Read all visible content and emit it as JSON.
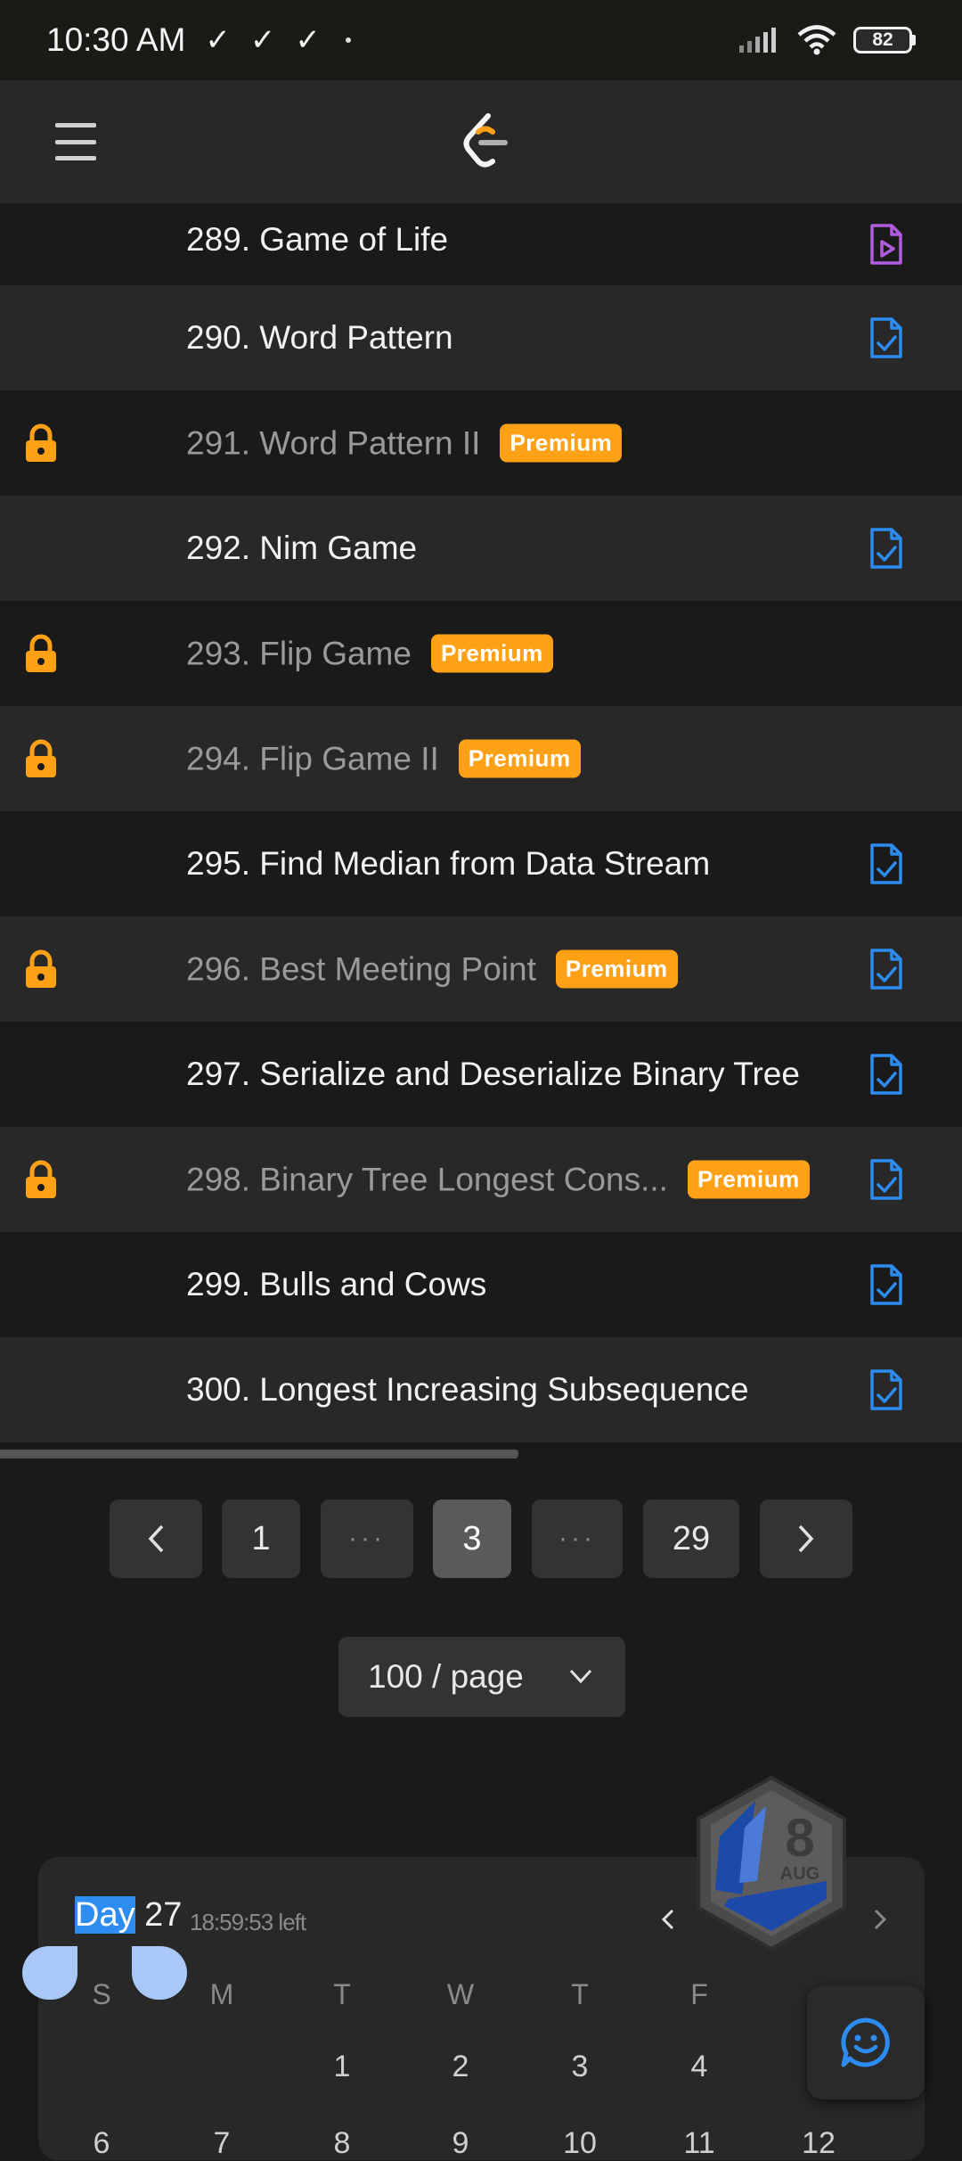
{
  "status_bar": {
    "time": "10:30 AM",
    "battery": "82"
  },
  "problems": [
    {
      "title": "289. Game of Life",
      "locked": false,
      "premium": false,
      "solution": "video"
    },
    {
      "title": "290. Word Pattern",
      "locked": false,
      "premium": false,
      "solution": "article"
    },
    {
      "title": "291. Word Pattern II",
      "locked": true,
      "premium": true,
      "solution": ""
    },
    {
      "title": "292. Nim Game",
      "locked": false,
      "premium": false,
      "solution": "article"
    },
    {
      "title": "293. Flip Game",
      "locked": true,
      "premium": true,
      "solution": ""
    },
    {
      "title": "294. Flip Game II",
      "locked": true,
      "premium": true,
      "solution": ""
    },
    {
      "title": "295. Find Median from Data Stream",
      "locked": false,
      "premium": false,
      "solution": "article"
    },
    {
      "title": "296. Best Meeting Point",
      "locked": true,
      "premium": true,
      "solution": "article"
    },
    {
      "title": "297. Serialize and Deserialize Binary Tree",
      "locked": false,
      "premium": false,
      "solution": "article"
    },
    {
      "title": "298. Binary Tree Longest Cons...",
      "locked": true,
      "premium": true,
      "solution": "article"
    },
    {
      "title": "299. Bulls and Cows",
      "locked": false,
      "premium": false,
      "solution": "article"
    },
    {
      "title": "300. Longest Increasing Subsequence",
      "locked": false,
      "premium": false,
      "solution": "article"
    }
  ],
  "premium_label": "Premium",
  "pagination": {
    "pages": [
      "1",
      "...",
      "3",
      "...",
      "29"
    ],
    "current": "3"
  },
  "per_page": "100 / page",
  "calendar": {
    "day_word": "Day",
    "day_number": "27",
    "time_left": "18:59:53 left",
    "weekdays": [
      "S",
      "M",
      "T",
      "W",
      "T",
      "F"
    ],
    "dates_row1": [
      "1",
      "2",
      "3",
      "4"
    ],
    "dates_row2": [
      "6",
      "7",
      "8",
      "9",
      "10",
      "11",
      "12"
    ]
  },
  "badge": {
    "number": "8",
    "month": "AUG"
  },
  "colors": {
    "accent": "#ffa116",
    "link_blue": "#2d8cf0",
    "video_purple": "#b05ce0"
  }
}
